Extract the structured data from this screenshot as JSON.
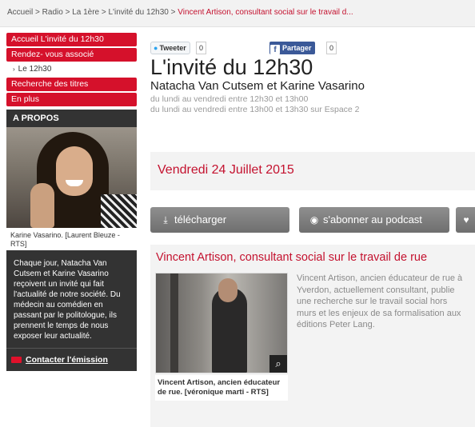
{
  "breadcrumb": {
    "items": [
      "Accueil",
      "Radio",
      "La 1ère",
      "L'invité du 12h30"
    ],
    "separator": " > ",
    "current": "Vincent Artison, consultant social sur le travail d..."
  },
  "sidebar": {
    "nav": [
      {
        "label": "Accueil L'invité du 12h30"
      },
      {
        "label": "Rendez- vous associé"
      },
      {
        "label": "Le 12h30",
        "sub": true
      },
      {
        "label": "Recherche des titres"
      },
      {
        "label": "En plus"
      }
    ],
    "about": {
      "heading": "A PROPOS",
      "photo_caption": "Karine Vasarino. [Laurent Bleuze - RTS]",
      "description": "Chaque jour, Natacha Van Cutsem et Karine Vasarino reçoivent un invité qui fait l'actualité de notre société. Du médecin au comédien en passant par le politologue, ils prennent le temps de nous exposer leur actualité.",
      "contact_label": "Contacter l'émission"
    }
  },
  "social": {
    "tweet_label": "Tweeter",
    "tweet_count": "0",
    "share_label": "Partager",
    "share_count": "0"
  },
  "show": {
    "title": "L'invité du 12h30",
    "hosts": "Natacha Van Cutsem et Karine Vasarino",
    "schedule": [
      "du lundi au vendredi entre 12h30 et 13h00",
      "du lundi au vendredi entre 13h00 et 13h30 sur Espace 2"
    ]
  },
  "episode": {
    "date": "Vendredi 24 Juillet 2015",
    "actions": {
      "download": "télécharger",
      "podcast": "s'abonner au podcast"
    },
    "title": "Vincent Artison, consultant social sur le travail de rue",
    "image_caption": "Vincent Artison, ancien éducateur de rue. [véronique marti - RTS]",
    "text": "Vincent Artison, ancien éducateur de rue à Yverdon, actuellement consultant, publie une recherche sur le travail social hors murs et les enjeux de sa formalisation aux éditions Peter Lang."
  },
  "colors": {
    "accent": "#d5112b",
    "dark_panel": "#333333",
    "button_grey": "#7f7f7f"
  }
}
